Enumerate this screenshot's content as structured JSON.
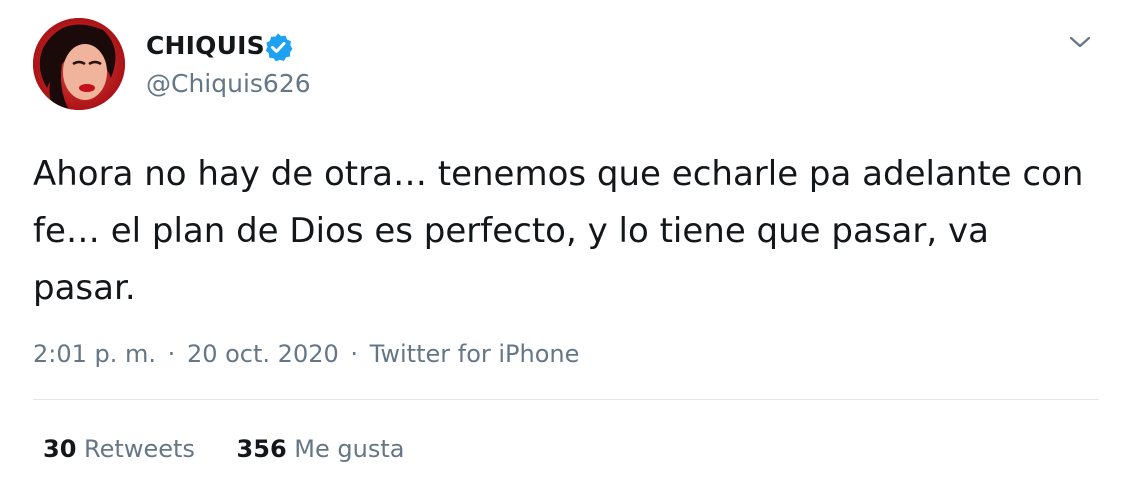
{
  "user": {
    "display_name": "CHIQUIS",
    "handle": "@Chiquis626",
    "verified": true,
    "avatar_icon": "profile-photo",
    "verified_icon": "verified-badge-icon"
  },
  "tweet": {
    "text": "Ahora no hay de otra… tenemos que echarle pa adelante con fe… el plan de Dios es perfecto, y lo tiene que pasar, va pasar.",
    "time": "2:01 p. m.",
    "date": "20 oct. 2020",
    "separator": "·",
    "source": "Twitter for iPhone"
  },
  "stats": {
    "retweets_count": "30",
    "retweets_label": "Retweets",
    "likes_count": "356",
    "likes_label": "Me gusta"
  },
  "colors": {
    "text": "#14171a",
    "secondary": "#657786",
    "verified": "#1da1f2",
    "divider": "#e1e8ed"
  },
  "menu": {
    "icon": "chevron-down-icon"
  }
}
